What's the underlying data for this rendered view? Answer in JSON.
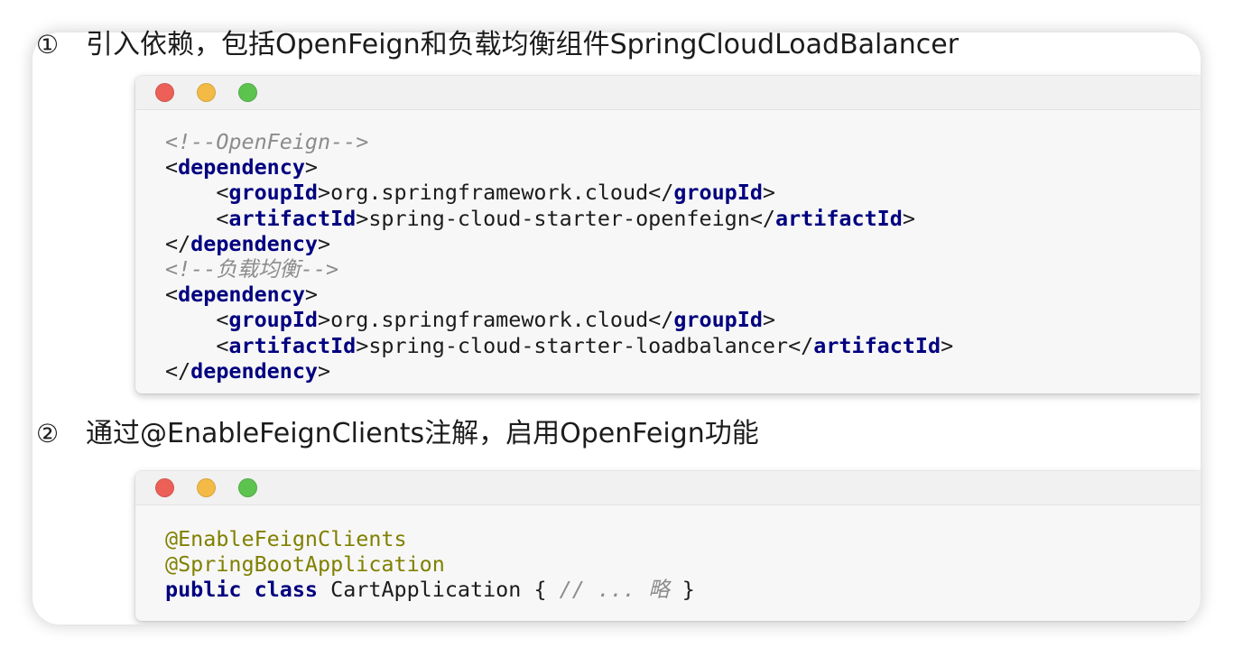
{
  "colors": {
    "tag": "#000080",
    "keyword": "#000080",
    "annotation": "#808000",
    "comment": "#8C8C8C",
    "close": "#EC6058",
    "minimize": "#F3BA45",
    "zoom": "#5CC34F"
  },
  "window_controls": [
    "traffic-light-close-icon",
    "traffic-light-minimize-icon",
    "traffic-light-zoom-icon"
  ],
  "steps": [
    {
      "marker": "①",
      "title": "引入依赖，包括OpenFeign和负载均衡组件SpringCloudLoadBalancer",
      "code_lines": [
        [
          "<!--OpenFeign-->"
        ],
        [
          "<",
          "dependency",
          ">"
        ],
        [
          "<",
          "groupId",
          ">",
          "org.springframework.cloud",
          "</",
          "groupId",
          ">"
        ],
        [
          "<",
          "artifactId",
          ">",
          "spring-cloud-starter-openfeign",
          "</",
          "artifactId",
          ">"
        ],
        [
          "</",
          "dependency",
          ">"
        ],
        [
          "<!--负载均衡-->"
        ],
        [
          "<",
          "dependency",
          ">"
        ],
        [
          "<",
          "groupId",
          ">",
          "org.springframework.cloud",
          "</",
          "groupId",
          ">"
        ],
        [
          "<",
          "artifactId",
          ">",
          "spring-cloud-starter-loadbalancer",
          "</",
          "artifactId",
          ">"
        ],
        [
          "</",
          "dependency",
          ">"
        ]
      ]
    },
    {
      "marker": "②",
      "title": "通过@EnableFeignClients注解，启用OpenFeign功能",
      "code_lines": [
        [
          "@EnableFeignClients"
        ],
        [
          "@SpringBootApplication"
        ],
        [
          "public",
          "class",
          "CartApplication",
          "{",
          "// ... 略",
          "}"
        ]
      ]
    }
  ]
}
